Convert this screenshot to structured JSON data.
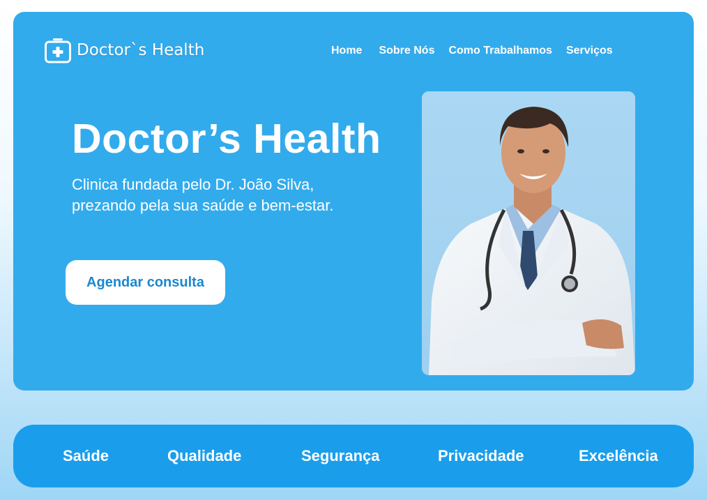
{
  "brand": {
    "name": "Doctor`s Health",
    "logo_icon": "medical-kit-icon"
  },
  "nav": {
    "items": [
      "Home",
      "Sobre Nós",
      "Como Trabalhamos",
      "Serviços"
    ]
  },
  "hero": {
    "title": "Doctor’s Health",
    "description": "Clinica fundada pelo Dr. João Silva, prezando pela sua saúde e bem-estar.",
    "cta_label": "Agendar consulta",
    "image": "doctor-portrait"
  },
  "values": {
    "items": [
      "Saúde",
      "Qualidade",
      "Segurança",
      "Privacidade",
      "Excelência"
    ]
  },
  "colors": {
    "hero_bg": "#32abec",
    "values_bg": "#1a9eec",
    "cta_text": "#1a88cf"
  }
}
